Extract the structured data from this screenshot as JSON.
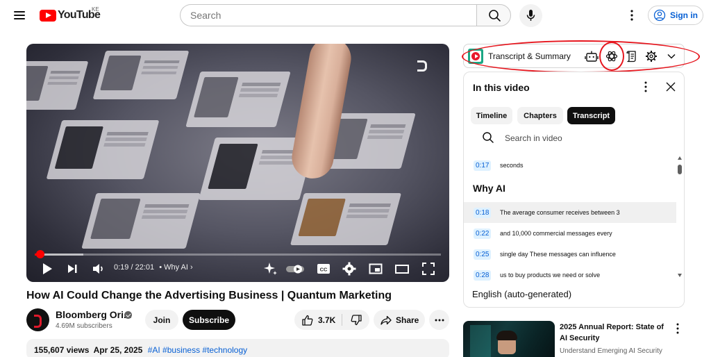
{
  "header": {
    "logo_text": "YouTube",
    "country_code": "KE",
    "search_placeholder": "Search",
    "signin_label": "Sign in"
  },
  "player": {
    "time_current": "0:19",
    "time_total": "22:01",
    "time_sep": " / ",
    "chapter_label": "• Why AI ›",
    "progress_played_fraction": 0.014,
    "progress_buffered_fraction": 0.12
  },
  "video": {
    "title": "How AI Could Change the Advertising Business | Quantum Marketing",
    "channel_name": "Bloomberg Ori...",
    "subscribers": "4.69M subscribers",
    "join_label": "Join",
    "subscribe_label": "Subscribe",
    "like_count": "3.7K",
    "share_label": "Share",
    "views": "155,607 views",
    "date": "Apr 25, 2025",
    "tags": "#AI #business #technology"
  },
  "extension": {
    "title": "Transcript & Summary",
    "icons": [
      "robot-icon",
      "chatgpt-icon",
      "scroll-icon",
      "gear-icon",
      "chevron-down-icon"
    ]
  },
  "panel": {
    "heading": "In this video",
    "tabs": [
      {
        "label": "Timeline",
        "active": false
      },
      {
        "label": "Chapters",
        "active": false
      },
      {
        "label": "Transcript",
        "active": true
      }
    ],
    "search_placeholder": "Search in video",
    "first_segment": {
      "time": "0:17",
      "text": "seconds"
    },
    "section_title": "Why AI",
    "segments": [
      {
        "time": "0:18",
        "text": "The average consumer receives between 3",
        "highlighted": true
      },
      {
        "time": "0:22",
        "text": "and 10,000 commercial messages every",
        "highlighted": false
      },
      {
        "time": "0:25",
        "text": "single day These messages can influence",
        "highlighted": false
      },
      {
        "time": "0:28",
        "text": "us to buy products we need or solve",
        "highlighted": false
      }
    ],
    "language": "English (auto-generated)"
  },
  "recommendation": {
    "title": "2025 Annual Report: State of AI Security",
    "channel": "Understand Emerging AI Security"
  },
  "colors": {
    "brand_red": "#ff0000",
    "link_blue": "#065fd4",
    "annotation_red": "#e6161e"
  }
}
